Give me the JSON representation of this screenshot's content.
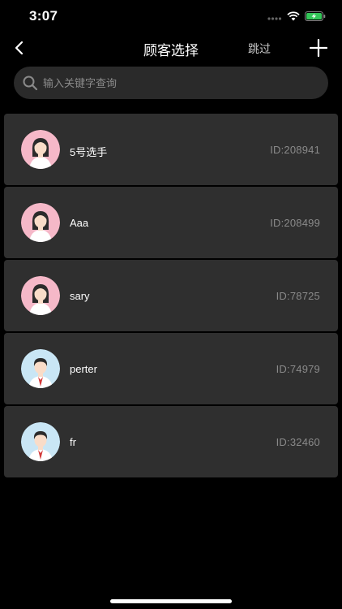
{
  "status_bar": {
    "time": "3:07",
    "icons": [
      "signal-dots-icon",
      "wifi-icon",
      "battery-charging-icon"
    ],
    "battery_color": "#34c759"
  },
  "nav": {
    "title": "顾客选择",
    "skip_label": "跳过",
    "back_icon": "chevron-left-icon",
    "add_icon": "plus-icon"
  },
  "search": {
    "placeholder": "输入关键字查询",
    "value": ""
  },
  "customers": [
    {
      "name": "5号选手",
      "id_text": "ID:208941",
      "avatar": "female-avatar-icon"
    },
    {
      "name": "Aaa",
      "id_text": "ID:208499",
      "avatar": "female-avatar-icon"
    },
    {
      "name": "sary",
      "id_text": "ID:78725",
      "avatar": "female-avatar-icon"
    },
    {
      "name": "perter",
      "id_text": "ID:74979",
      "avatar": "male-avatar-icon"
    },
    {
      "name": "fr",
      "id_text": "ID:32460",
      "avatar": "male-avatar-icon"
    }
  ],
  "colors": {
    "background": "#000000",
    "card": "#2f2f2f",
    "search_bg": "#2a2a2a",
    "female_avatar_bg": "#f5b8c8",
    "male_avatar_bg": "#c9e6f5"
  }
}
